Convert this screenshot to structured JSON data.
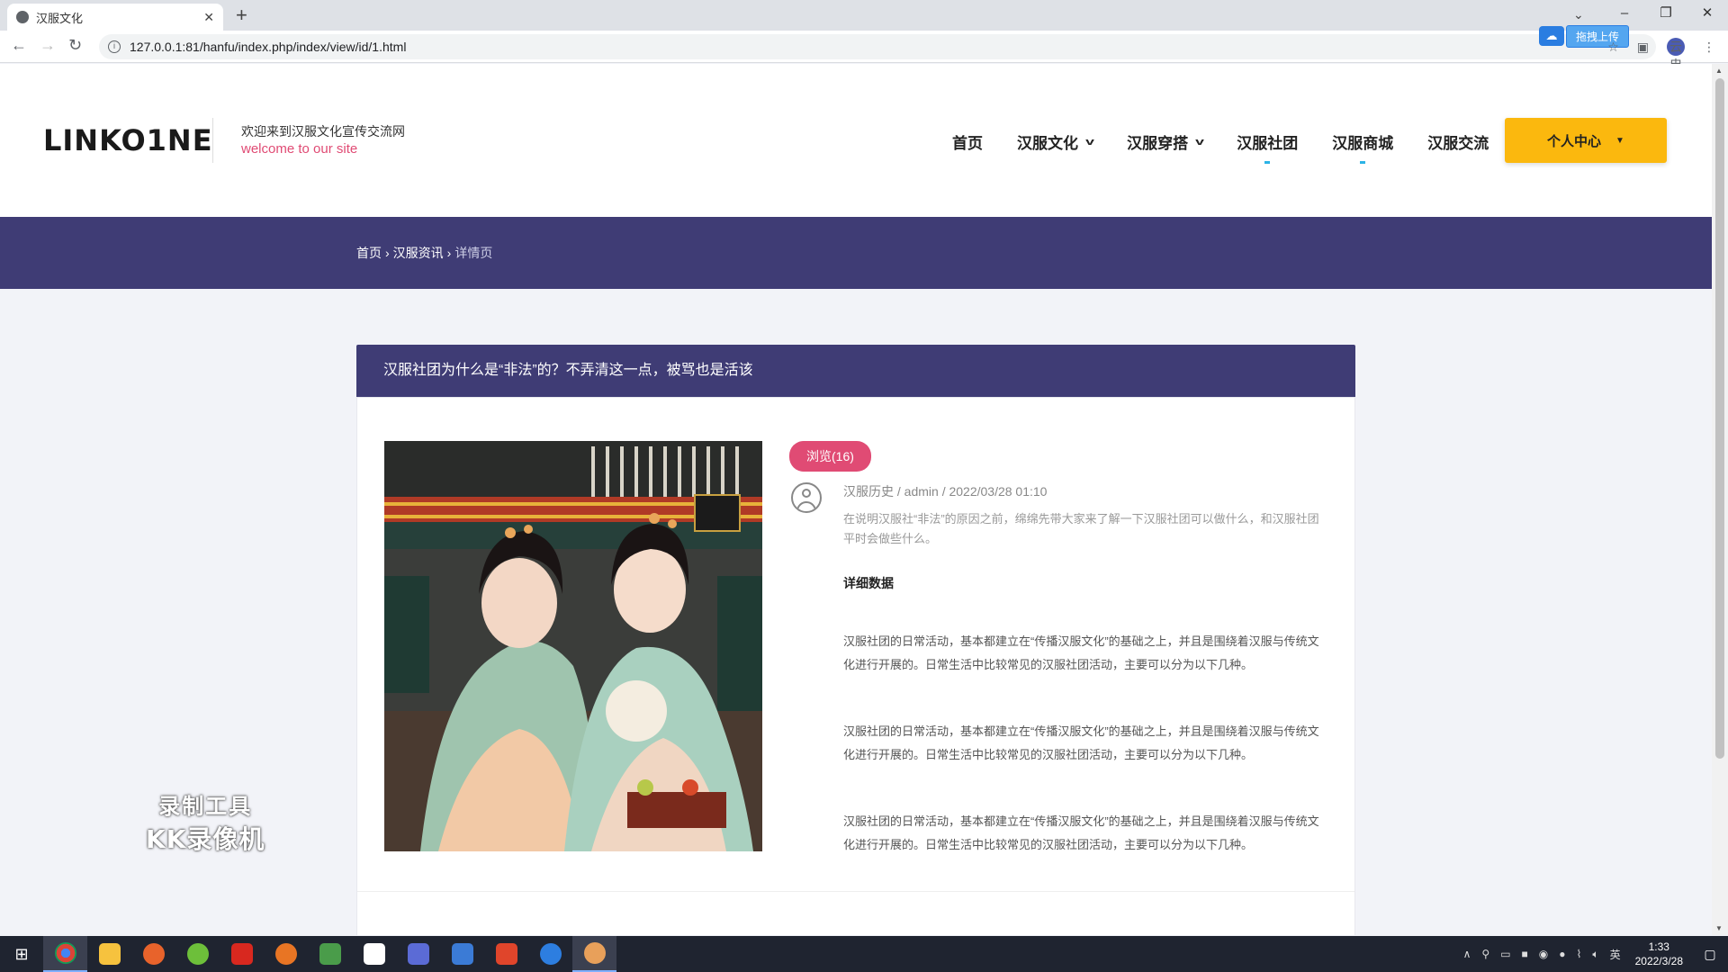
{
  "browser": {
    "tab_title": "汉服文化",
    "new_tab": "+",
    "url": "127.0.0.1:81/hanfu/index.php/index/view/id/1.html",
    "extension_upload_label": "拖拽上传",
    "profile_initial": "云忠"
  },
  "header": {
    "logo": "LINKO1NE",
    "welcome": "欢迎来到汉服文化宣传交流网",
    "welcome_en": "welcome to our site",
    "nav": [
      {
        "label": "首页",
        "has_dropdown": false
      },
      {
        "label": "汉服文化",
        "has_dropdown": true
      },
      {
        "label": "汉服穿搭",
        "has_dropdown": true
      },
      {
        "label": "汉服社团",
        "has_dropdown": false
      },
      {
        "label": "汉服商城",
        "has_dropdown": false
      },
      {
        "label": "汉服交流",
        "has_dropdown": false
      }
    ],
    "personal_center": "个人中心",
    "accent_color": "#fbb80e"
  },
  "breadcrumb": {
    "home": "首页",
    "category": "汉服资讯",
    "current": "详情页",
    "separator": "›"
  },
  "article": {
    "title": "汉服社团为什么是“非法”的？不弄清这一点，被骂也是活该",
    "views": "浏览(16)",
    "meta": "汉服历史 / admin / 2022/03/28 01:10",
    "summary": "在说明汉服社“非法”的原因之前，绵绵先带大家来了解一下汉服社团可以做什么，和汉服社团平时会做些什么。",
    "detail_heading": "详细数据",
    "paragraphs": [
      "汉服社团的日常活动，基本都建立在“传播汉服文化”的基础之上，并且是围绕着汉服与传统文化进行开展的。日常生活中比较常见的汉服社团活动，主要可以分为以下几种。",
      "汉服社团的日常活动，基本都建立在“传播汉服文化”的基础之上，并且是围绕着汉服与传统文化进行开展的。日常生活中比较常见的汉服社团活动，主要可以分为以下几种。",
      "汉服社团的日常活动，基本都建立在“传播汉服文化”的基础之上，并且是围绕着汉服与传统文化进行开展的。日常生活中比较常见的汉服社团活动，主要可以分为以下几种。"
    ],
    "banner_color": "#3f3c75",
    "badge_color": "#e04b74"
  },
  "watermark": {
    "line1": "录制工具",
    "line2": "KK录像机"
  },
  "taskbar": {
    "lang": "英",
    "time": "1:33",
    "date": "2022/3/28"
  }
}
